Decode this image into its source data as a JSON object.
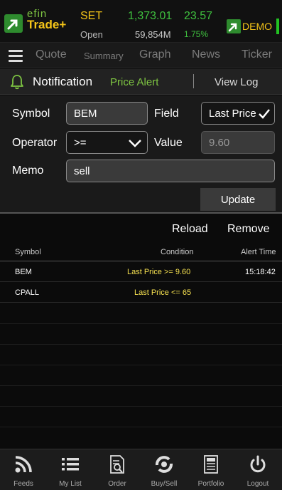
{
  "header": {
    "brand_top": "efin",
    "brand_bottom": "Trade+",
    "market": "SET",
    "market_status": "Open",
    "index_value": "1,373.01",
    "index_change": "23.57",
    "volume": "59,854M",
    "change_pct": "1.75%",
    "demo_label": "DEMO"
  },
  "nav": {
    "items": [
      "Quote",
      "Summary",
      "Graph",
      "News",
      "Ticker"
    ]
  },
  "subtabs": {
    "notification": "Notification",
    "price_alert": "Price Alert",
    "view_log": "View Log"
  },
  "form": {
    "symbol_label": "Symbol",
    "symbol_value": "BEM",
    "field_label": "Field",
    "field_value": "Last Price",
    "operator_label": "Operator",
    "operator_value": ">=",
    "value_label": "Value",
    "value_value": "9.60",
    "memo_label": "Memo",
    "memo_value": "sell",
    "update_label": "Update"
  },
  "actions": {
    "reload": "Reload",
    "remove": "Remove"
  },
  "table": {
    "headers": {
      "symbol": "Symbol",
      "condition": "Condition",
      "alert_time": "Alert Time"
    },
    "rows": [
      {
        "symbol": "BEM",
        "condition": "Last Price >= 9.60",
        "alert_time": "15:18:42"
      },
      {
        "symbol": "CPALL",
        "condition": "Last Price <= 65",
        "alert_time": ""
      }
    ]
  },
  "bottom_nav": {
    "items": [
      {
        "label": "Feeds",
        "icon": "feeds-icon"
      },
      {
        "label": "My List",
        "icon": "list-icon"
      },
      {
        "label": "Order",
        "icon": "order-icon"
      },
      {
        "label": "Buy/Sell",
        "icon": "buysell-icon"
      },
      {
        "label": "Portfolio",
        "icon": "portfolio-icon"
      },
      {
        "label": "Logout",
        "icon": "power-icon"
      }
    ]
  },
  "colors": {
    "accent_green": "#3fc13f",
    "brand_yellow": "#f5c518",
    "condition_yellow": "#f5e050",
    "price_alert_green": "#7ec542"
  }
}
